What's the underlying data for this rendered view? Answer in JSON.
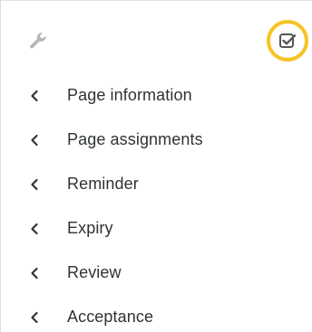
{
  "toolbar": {
    "left_icon": "wrench-icon",
    "right_icon": "checkbox-checked-icon",
    "highlight_color": "#f7c325"
  },
  "nav": {
    "items": [
      {
        "label": "Page information",
        "icon": "chevron-left-icon"
      },
      {
        "label": "Page assignments",
        "icon": "chevron-left-icon"
      },
      {
        "label": "Reminder",
        "icon": "chevron-left-icon"
      },
      {
        "label": "Expiry",
        "icon": "chevron-left-icon"
      },
      {
        "label": "Review",
        "icon": "chevron-left-icon"
      },
      {
        "label": "Acceptance",
        "icon": "chevron-left-icon"
      }
    ]
  },
  "colors": {
    "text": "#2f3336",
    "icon_muted": "#b5b5b5",
    "icon_dark": "#555555"
  }
}
